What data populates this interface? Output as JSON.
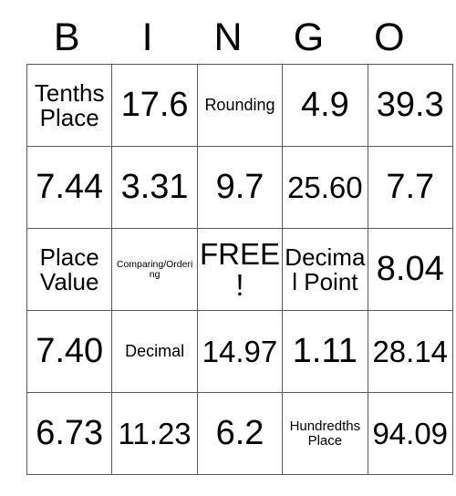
{
  "card": {
    "title": "BINGO",
    "header": [
      "B",
      "I",
      "N",
      "G",
      "O"
    ],
    "free_space_label": "FREE!",
    "colors": {
      "border": "#595959",
      "text": "#000000",
      "background": "#ffffff"
    },
    "rows": [
      [
        {
          "text": "Tenths Place",
          "size": "md"
        },
        {
          "text": "17.6",
          "size": "xl"
        },
        {
          "text": "Rounding",
          "size": "sm"
        },
        {
          "text": "4.9",
          "size": "xl"
        },
        {
          "text": "39.3",
          "size": "xl"
        }
      ],
      [
        {
          "text": "7.44",
          "size": "xl"
        },
        {
          "text": "3.31",
          "size": "xl"
        },
        {
          "text": "9.7",
          "size": "xl"
        },
        {
          "text": "25.60",
          "size": "lg"
        },
        {
          "text": "7.7",
          "size": "xl"
        }
      ],
      [
        {
          "text": "Place Value",
          "size": "md"
        },
        {
          "text": "Comparing/Ordering",
          "size": "xxs"
        },
        {
          "text": "FREE!",
          "size": "lg",
          "free": true
        },
        {
          "text": "Decimal Point",
          "size": "md"
        },
        {
          "text": "8.04",
          "size": "xl"
        }
      ],
      [
        {
          "text": "7.40",
          "size": "xl"
        },
        {
          "text": "Decimal",
          "size": "sm"
        },
        {
          "text": "14.97",
          "size": "lg"
        },
        {
          "text": "1.11",
          "size": "xl"
        },
        {
          "text": "28.14",
          "size": "lg"
        }
      ],
      [
        {
          "text": "6.73",
          "size": "xl"
        },
        {
          "text": "11.23",
          "size": "lg"
        },
        {
          "text": "6.2",
          "size": "xl"
        },
        {
          "text": "Hundredths Place",
          "size": "xs"
        },
        {
          "text": "94.09",
          "size": "lg"
        }
      ]
    ]
  }
}
